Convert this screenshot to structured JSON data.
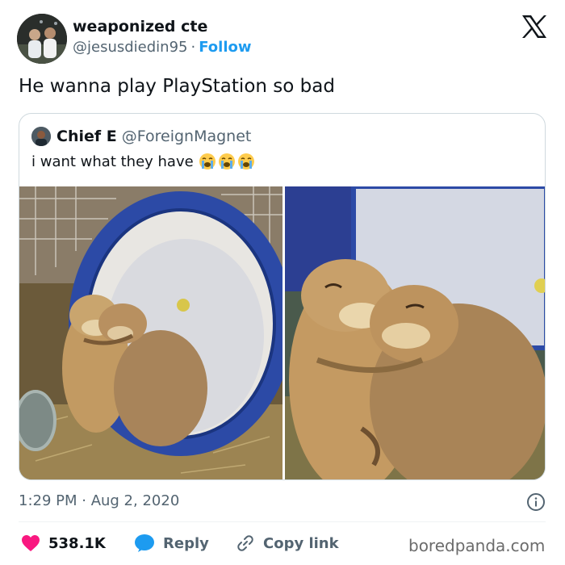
{
  "author": {
    "name": "weaponized cte",
    "handle": "@jesusdiedin95",
    "separator": "·",
    "follow_label": "Follow"
  },
  "tweet": {
    "text": "He wanna play PlayStation so bad"
  },
  "quoted_tweet": {
    "name": "Chief E",
    "handle": "@ForeignMagnet",
    "text": "i want what they have",
    "emoji": [
      "loudly-crying-face",
      "loudly-crying-face",
      "loudly-crying-face"
    ]
  },
  "meta": {
    "timestamp": "1:29 PM · Aug 2, 2020"
  },
  "actions": {
    "like_count": "538.1K",
    "reply_label": "Reply",
    "copy_link_label": "Copy link"
  },
  "watermark": "boredpanda.com",
  "colors": {
    "accent": "#1d9bf0",
    "like": "#f91880",
    "text": "#0f1419",
    "muted": "#536471",
    "border": "#cfd9de"
  },
  "icons": {
    "platform": "x-logo-icon",
    "info": "info-icon",
    "like": "heart-icon",
    "reply": "speech-bubble-icon",
    "copy": "link-icon"
  }
}
